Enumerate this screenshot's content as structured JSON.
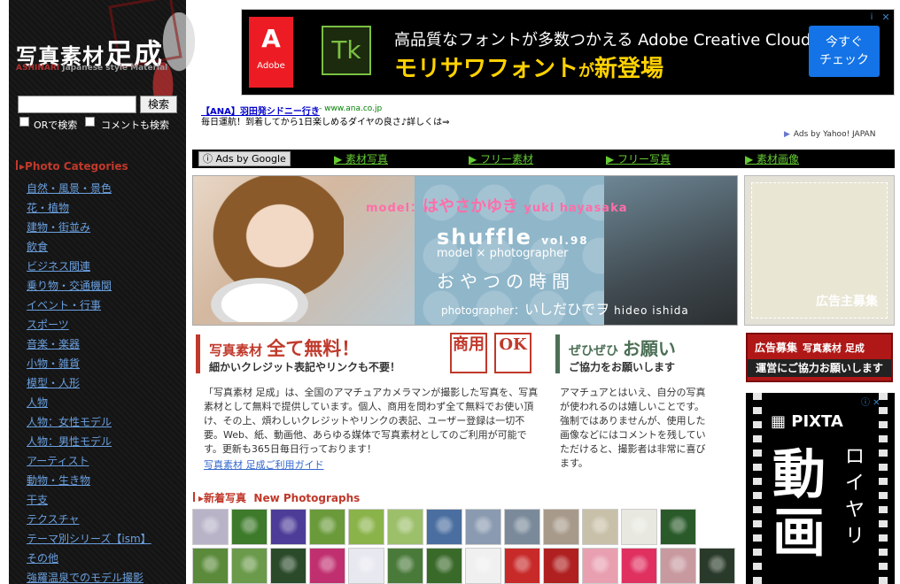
{
  "sidebar": {
    "logo_main": "写真素材",
    "logo_big": "足成",
    "logo_sub_en": "ASHINARI",
    "logo_sub_desc": "Japanese style Material",
    "search_button": "検索",
    "search_value": "",
    "or_search_label": "ORで検索",
    "comment_search_label": "コメントも検索",
    "categories_heading": "Photo Categories",
    "categories": [
      "自然・風景・景色",
      "花・植物",
      "建物・街並み",
      "飲食",
      "ビジネス関連",
      "乗り物・交通機関",
      "イベント・行事",
      "スポーツ",
      "音楽・楽器",
      "小物・雑貨",
      "模型・人形",
      "人物",
      "人物：女性モデル",
      "人物：男性モデル",
      "アーティスト",
      "動物・生き物",
      "干支",
      "テクスチャ",
      "テーマ別シリーズ【ism】",
      "その他",
      "強羅温泉でのモデル撮影"
    ]
  },
  "top_ad": {
    "adobe_label": "Adobe",
    "tk_label": "Tk",
    "line1": "高品質なフォントが多数つかえる Adobe Creative Cloudに",
    "line2_main": "モリサワフォント",
    "line2_small": "が",
    "line2_end": "新登場",
    "cta_line1": "今すぐ",
    "cta_line2": "チェック",
    "info_icon": "i",
    "close_icon": "✕"
  },
  "text_ad": {
    "title": "【ANA】羽田発シドニー行き",
    "url": "- www.ana.co.jp",
    "desc": "毎日運航！到着してから1日楽しめるダイヤの良さ♪詳しくは⇒",
    "ads_by": "Ads by Yahoo! JAPAN"
  },
  "ad_nav": {
    "ads_by_google": "Ads by Google",
    "links": [
      "▶ 素材写真",
      "▶ フリー素材",
      "▶ フリー写真",
      "▶ 素材画像"
    ]
  },
  "feature": {
    "model_label": "model：",
    "model_name": "はやさかゆき",
    "model_name_en": "yuki hayasaka",
    "series": "shuffle",
    "vol": "vol.98",
    "subtitle": "model × photographer",
    "theme": "おやつの時間",
    "photographer_label": "photographer：",
    "photographer_name": "いしだひでヲ",
    "photographer_name_en": "hideo ishida"
  },
  "right": {
    "ad_space_text": "広告主募集",
    "sponsor_line1": "広告募集",
    "sponsor_line1_small": "写真素材 足成",
    "sponsor_line2": "運営にご協力お願いします",
    "pixta_logo": "PIXTA",
    "pixta_big": "動画",
    "pixta_royalty": "ロイヤリ"
  },
  "intro": {
    "free_title_pre": "写真素材",
    "free_title_big": "全て無料！",
    "free_sub": "細かいクレジット表記やリンクも不要！",
    "seal1": "商用",
    "seal2": "OK",
    "please_pre": "ぜひぜひ",
    "please_big": "お願い",
    "please_sub": "ご協力をお願いします",
    "body": "「写真素材 足成」は、全国のアマチュアカメラマンが撮影した写真を、写真素材として無料で提供しています。個人、商用を問わず全て無料でお使い頂け、その上、煩わしいクレジットやリンクの表記、ユーザー登録は一切不要。Web、紙、動画他、あらゆる媒体で写真素材としてのご利用が可能です。更新も365日毎日行っております！",
    "guide_link": "写真素材 足成ご利用ガイド",
    "please_body": "アマチュアとはいえ、自分の写真が使われるのは嬉しいことです。強制ではありませんが、使用した画像などにはコメントを残していただけると、撮影者は非常に喜びます。"
  },
  "new_photos": {
    "heading_jp": "新着写真",
    "heading_en": "New Photographs",
    "row1_colors": [
      "#b9b3c8",
      "#3d7a2a",
      "#4d3d99",
      "#6a9a3a",
      "#8ab34a",
      "#9cbf6a",
      "#4a6ea0",
      "#8a9ab0",
      "#7a8a9a",
      "#a89a8a",
      "#c8c0a8",
      "#e8e8e0",
      "#2a5a2a"
    ],
    "row2_colors": [
      "#5a8a3a",
      "#6a9a4a",
      "#2a4a2a",
      "#c03070",
      "#e8e8f0",
      "#4a7a3a",
      "#3a6a2a",
      "#f0f0f0",
      "#c82a2a",
      "#b02020",
      "#e8a0b0",
      "#e03060",
      "#c89aa0",
      "#2a3a2a"
    ]
  }
}
